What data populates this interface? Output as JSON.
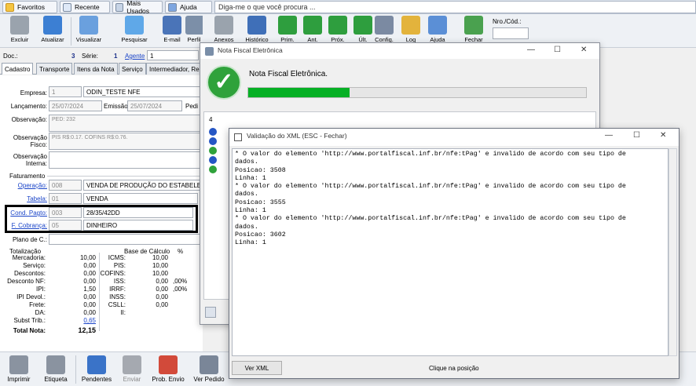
{
  "topbar": {
    "tabs": [
      "Favoritos",
      "Recente",
      "Mais Usados",
      "Ajuda"
    ],
    "search_text": "Diga-me o que você procura ..."
  },
  "toolbar": {
    "buttons": [
      "Excluir",
      "Atualizar",
      "Visualizar",
      "Pesquisar",
      "E-mail",
      "Perfil",
      "Anexos",
      "Histórico",
      "Prim.",
      "Ant.",
      "Próx.",
      "Últ.",
      "Config.",
      "Log",
      "Ajuda",
      "Fechar"
    ],
    "nro_label": "Nro./Cód.:"
  },
  "doc": {
    "doc_label": "Doc.:",
    "doc_value": "3",
    "serie_label": "Série:",
    "serie_value": "1",
    "agente_label": "Agente",
    "agente_value": "1"
  },
  "form_tabs": [
    "Cadastro",
    "Transporte",
    "Itens da Nota",
    "Serviço",
    "Intermediador, Re"
  ],
  "form": {
    "empresa_label": "Empresa:",
    "empresa_code": "1",
    "empresa_name": "ODIN_TESTE NFE",
    "lancamento_label": "Lançamento:",
    "lancamento_value": "25/07/2024",
    "emissao_label": "Emissão",
    "emissao_value": "25/07/2024",
    "pedido_label": "Pedi",
    "observacao_label": "Observação:",
    "observacao_value": "PED: 232",
    "obs_fisco_label1": "Observação",
    "obs_fisco_label2": "Fisco:",
    "obs_fisco_value": "PIS R$:0.17. COFINS R$:0.76.",
    "obs_interna_label1": "Observação",
    "obs_interna_label2": "Interna:",
    "faturamento_label": "Faturamento",
    "operacao_label": "Operação:",
    "operacao_code": "008",
    "operacao_name": "VENDA DE PRODUÇÃO DO ESTABELECIM",
    "tabela_label": "Tabela:",
    "tabela_code": "01",
    "tabela_name": "VENDA",
    "cond_label": "Cond. Pagto:",
    "cond_code": "003",
    "cond_name": "28/35/42DD",
    "fcob_label": "F. Cobrança:",
    "fcob_code": "05",
    "fcob_name": "DINHEIRO",
    "plano_label": "Plano de C.:"
  },
  "totals": {
    "header_left": "Totalização",
    "header_base": "Base de Cálculo",
    "header_pct": "%",
    "left": [
      {
        "label": "Mercadoria:",
        "value": "10,00"
      },
      {
        "label": "Serviço:",
        "value": "0,00"
      },
      {
        "label": "Descontos:",
        "value": "0,00"
      },
      {
        "label": "Desconto NF:",
        "value": "0,00"
      },
      {
        "label": "IPI:",
        "value": "1,50"
      },
      {
        "label": "IPI Devol.:",
        "value": "0,00"
      },
      {
        "label": "Frete:",
        "value": "0,00"
      },
      {
        "label": "DA:",
        "value": "0,00"
      },
      {
        "label": "Subst Trib.:",
        "value": "0,65"
      }
    ],
    "right": [
      {
        "label": "ICMS:",
        "value": "10,00",
        "pct": ""
      },
      {
        "label": "PIS:",
        "value": "10,00",
        "pct": ""
      },
      {
        "label": "COFINS:",
        "value": "10,00",
        "pct": ""
      },
      {
        "label": "ISS:",
        "value": "0,00",
        "pct": ",00%"
      },
      {
        "label": "IRRF:",
        "value": "0,00",
        "pct": ",00%"
      },
      {
        "label": "INSS:",
        "value": "0,00",
        "pct": ""
      },
      {
        "label": "CSLL:",
        "value": "0,00",
        "pct": ""
      },
      {
        "label": "II:",
        "value": "",
        "pct": ""
      }
    ],
    "total_label": "Total Nota:",
    "total_value": "12,15"
  },
  "bottom": {
    "buttons": [
      "Imprimir",
      "Etiqueta",
      "Pendentes",
      "Enviar",
      "Prob. Envio",
      "Ver Pedido"
    ]
  },
  "nf_window": {
    "title": "Nota Fiscal Eletrônica",
    "status_text": "Nota Fiscal Eletrônica.",
    "progress": 0.3,
    "list_count": "4",
    "accent": "#06b025"
  },
  "xml_window": {
    "title": "Validação do XML (ESC - Fechar)",
    "content": "* O valor do elemento 'http://www.portalfiscal.inf.br/nfe:tPag' e invalido de acordo com seu tipo de\ndados.\nPosicao: 3508\nLinha: 1\n* O valor do elemento 'http://www.portalfiscal.inf.br/nfe:tPag' e invalido de acordo com seu tipo de\ndados.\nPosicao: 3555\nLinha: 1\n* O valor do elemento 'http://www.portalfiscal.inf.br/nfe:tPag' e invalido de acordo com seu tipo de\ndados.\nPosicao: 3602\nLinha: 1",
    "ver_xml_label": "Ver XML",
    "click_hint": "Clique na posição"
  }
}
